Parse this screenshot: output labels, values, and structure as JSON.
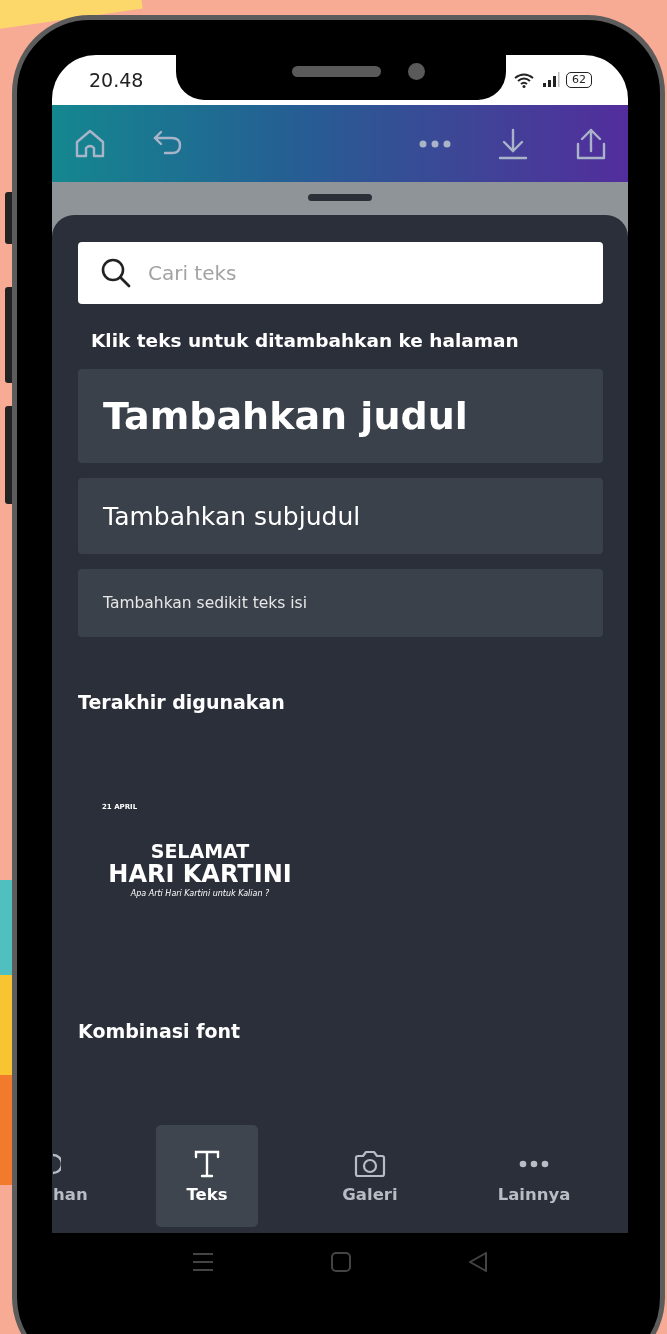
{
  "status_bar": {
    "time": "20.48",
    "battery": "62"
  },
  "search": {
    "placeholder": "Cari teks"
  },
  "instruction": "Klik teks untuk ditambahkan ke halaman",
  "text_options": [
    {
      "kind": "heading",
      "label": "Tambahkan judul"
    },
    {
      "kind": "subheading",
      "label": "Tambahkan subjudul"
    },
    {
      "kind": "body",
      "label": "Tambahkan sedikit teks isi"
    }
  ],
  "recent": {
    "title": "Terakhir digunakan",
    "template": {
      "date": "21 APRIL",
      "line_1": "SELAMAT",
      "line_2": "HARI KARTINI",
      "subtitle": "Apa Arti Hari Kartini untuk Kalian ?"
    }
  },
  "font_combinations": {
    "title": "Kombinasi font"
  },
  "bottom_tabs": [
    {
      "kind": "partial",
      "label": "han",
      "selected": false
    },
    {
      "kind": "text",
      "label": "Teks",
      "selected": true
    },
    {
      "kind": "camera",
      "label": "Galeri",
      "selected": false
    },
    {
      "kind": "more",
      "label": "Lainnya",
      "selected": false
    }
  ]
}
